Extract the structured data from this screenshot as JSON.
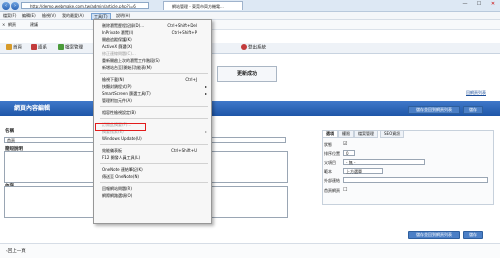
{
  "browser": {
    "address": "http://demo.webmake.com.tw/admin/article.php?i=6",
    "tab_title": "網站管理 - 東莞市齊方機電...",
    "fav_label": "網頁",
    "fav_label2": "建議",
    "close_tab": "×",
    "window_controls": [
      "—",
      "☐",
      "✕"
    ]
  },
  "menubar": [
    "檔案(F)",
    "編輯(E)",
    "檢視(V)",
    "我的最愛(A)",
    "工具(T)",
    "說明(H)"
  ],
  "app_toolbar": {
    "items": [
      {
        "label": "首頁",
        "color": "#d79b2a"
      },
      {
        "label": "語系",
        "color": "#c23b3b"
      },
      {
        "label": "檔案管理",
        "color": "#4b9b3a"
      },
      {
        "label": "登出系統",
        "color": "#c23b3b"
      }
    ]
  },
  "success_message": "更新成功",
  "return_link": "回網頁列表",
  "section": {
    "title": "網頁內容編輯",
    "save_list_button": "儲存並回到網頁列表",
    "save_button": "儲存"
  },
  "fields": {
    "name_label": "名稱",
    "name_value": "首頁",
    "desc_label": "簡短說明",
    "content_label": "內容"
  },
  "panel": {
    "tabs": [
      "選項",
      "權限",
      "檔案管理",
      "SEO資訊"
    ],
    "rows": [
      {
        "label": "狀態",
        "value": "☑"
      },
      {
        "label": "排序位置",
        "value": "0"
      },
      {
        "label": "父項目",
        "value": "- 無 -"
      },
      {
        "label": "範本",
        "value": "上方選單"
      },
      {
        "label": "外部連結",
        "value": ""
      },
      {
        "label": "首頁網頁",
        "value": "☐"
      }
    ]
  },
  "bottom": {
    "save_list_button": "儲存並回到網頁列表",
    "save_button": "儲存",
    "back_link": "‹回上一頁"
  },
  "tools_menu": {
    "items": [
      {
        "label": "刪除瀏覽歷程記錄(D)...",
        "shortcut": "Ctrl+Shift+Del",
        "disabled": false
      },
      {
        "label": "InPrivate 瀏覽(I)",
        "shortcut": "Ctrl+Shift+P",
        "disabled": false
      },
      {
        "label": "開啟追蹤保護(K)",
        "shortcut": "",
        "disabled": false
      },
      {
        "label": "ActiveX 篩選(X)",
        "shortcut": "",
        "disabled": false
      },
      {
        "label": "修正連線問題(C)...",
        "shortcut": "",
        "disabled": true
      },
      {
        "label": "重新開啟上次的瀏覽工作階段(S)",
        "shortcut": "",
        "disabled": false
      },
      {
        "label": "新增站台至[開始]功能表(M)",
        "shortcut": "",
        "disabled": false
      },
      {
        "label": "檢視下載(N)",
        "shortcut": "Ctrl+J",
        "disabled": false
      },
      {
        "label": "快顯封鎖程式(P)",
        "shortcut": "",
        "disabled": false,
        "submenu": true
      },
      {
        "label": "SmartScreen 篩選工具(T)",
        "shortcut": "",
        "disabled": false,
        "submenu": true
      },
      {
        "label": "管理附加元件(A)",
        "shortcut": "",
        "disabled": false
      },
      {
        "label": "相容性檢視設定(B)",
        "shortcut": "",
        "disabled": false
      },
      {
        "label": "訂閱此摘要(F)...",
        "shortcut": "",
        "disabled": true
      },
      {
        "label": "摘要搜索(E)",
        "shortcut": "",
        "disabled": true,
        "submenu": true
      },
      {
        "label": "Windows Update(U)",
        "shortcut": "",
        "disabled": false
      },
      {
        "label": "效能儀表板",
        "shortcut": "Ctrl+Shift+U",
        "disabled": false
      },
      {
        "label": "F12 開發人員工具(L)",
        "shortcut": "",
        "disabled": false
      },
      {
        "label": "OneNote 連結筆記(K)",
        "shortcut": "",
        "disabled": false
      },
      {
        "label": "傳送至 OneNote(N)",
        "shortcut": "",
        "disabled": false
      },
      {
        "label": "回報網站問題(R)",
        "shortcut": "",
        "disabled": false
      },
      {
        "label": "網際網路選項(O)",
        "shortcut": "",
        "disabled": false
      }
    ]
  },
  "colors": {
    "accent": "#1e56a8",
    "highlight": "#e21c1c"
  }
}
